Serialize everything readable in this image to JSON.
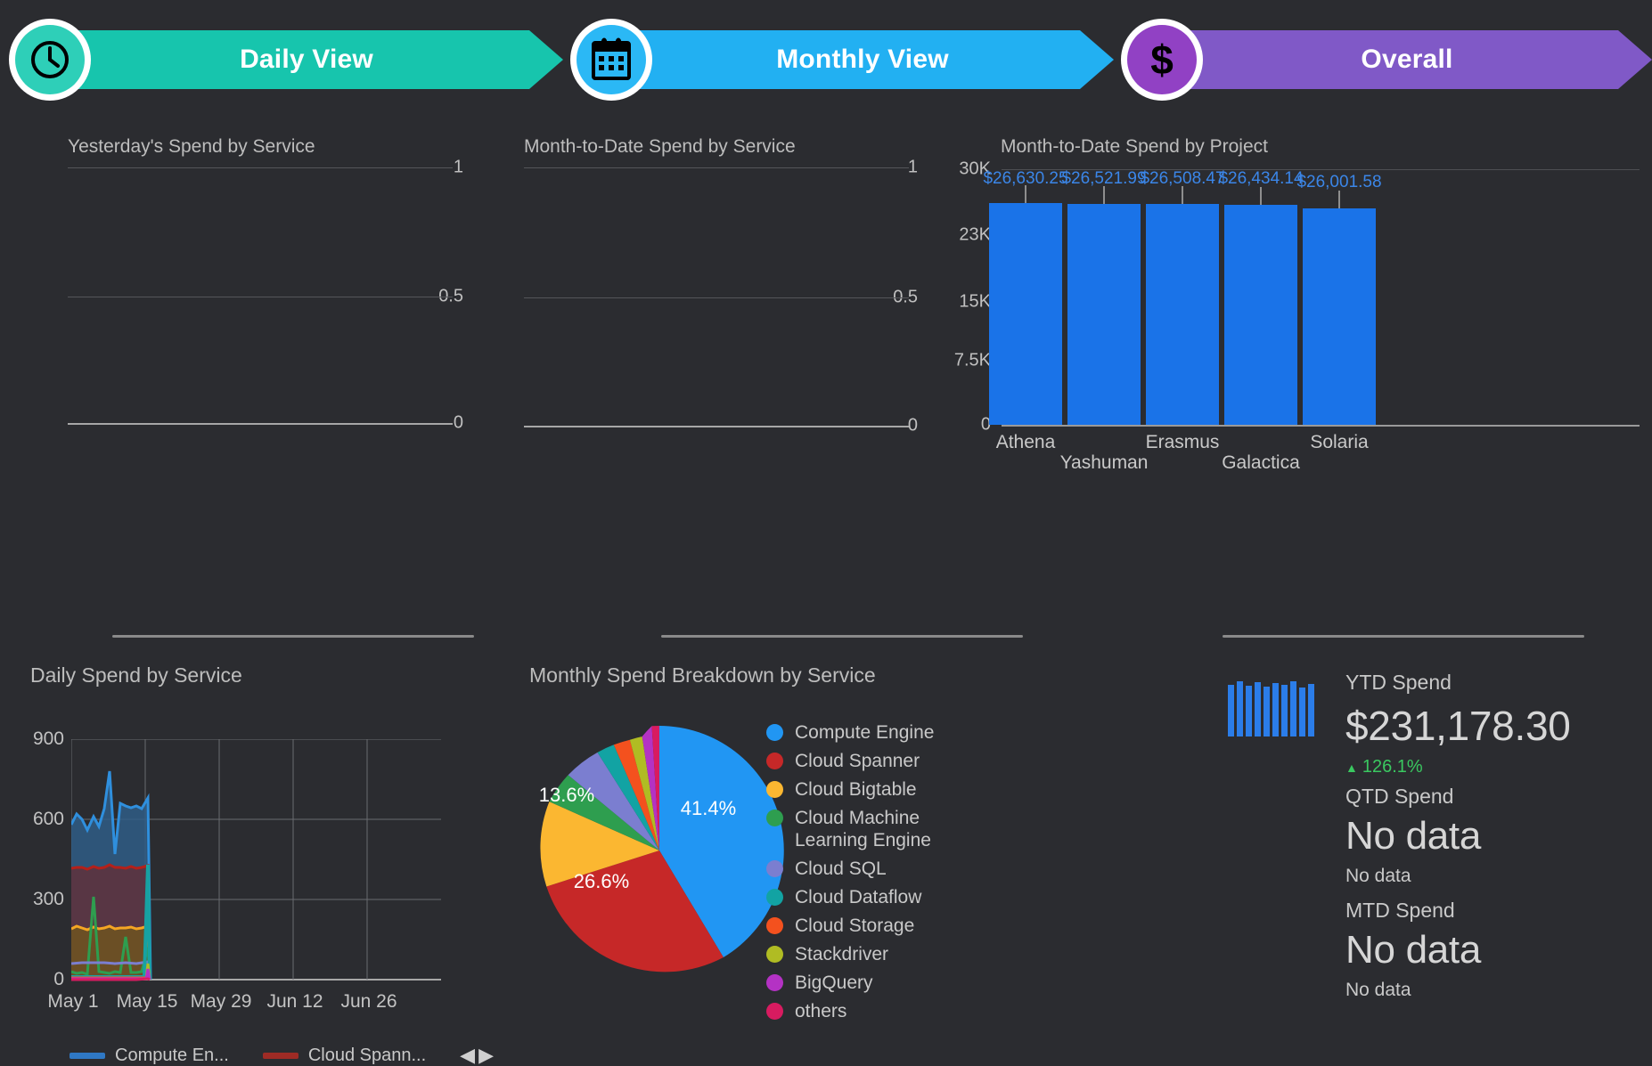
{
  "tabs": [
    {
      "label": "Daily View",
      "icon": "clock-icon",
      "color": "#17c5ad",
      "badge_color": "#2ecfb8"
    },
    {
      "label": "Monthly View",
      "icon": "calendar-icon",
      "color": "#22b0f2",
      "badge_color": "#2bb8f5"
    },
    {
      "label": "Overall",
      "icon": "dollar-icon",
      "color": "#8059c7",
      "badge_color": "#9141c4"
    }
  ],
  "panels": {
    "yesterday_title": "Yesterday's Spend by Service",
    "month_to_date_service_title": "Month-to-Date Spend by Service",
    "month_to_date_project_title": "Month-to-Date Spend by Project",
    "daily_spend_title": "Daily Spend by Service",
    "monthly_breakdown_title": "Monthly Spend Breakdown by Service"
  },
  "chart_data": [
    {
      "type": "bar",
      "title": "Yesterday's Spend by Service",
      "categories": [],
      "values": [],
      "ytick_labels": [
        "1",
        "0.5",
        "0"
      ],
      "ylim": [
        0,
        1
      ],
      "grid": true,
      "empty": true
    },
    {
      "type": "bar",
      "title": "Month-to-Date Spend by Service",
      "categories": [],
      "values": [],
      "ytick_labels": [
        "1",
        "0.5",
        "0"
      ],
      "ylim": [
        0,
        1
      ],
      "grid": true,
      "empty": true
    },
    {
      "type": "bar",
      "title": "Month-to-Date Spend by Project",
      "categories": [
        "Athena",
        "Yashuman",
        "Erasmus",
        "Galactica",
        "Solaria"
      ],
      "values": [
        26630.25,
        26521.99,
        26508.47,
        26434.14,
        26001.58
      ],
      "value_labels": [
        "$26,630.25",
        "$26,521.99",
        "$26,508.47",
        "$26,434.14",
        "$26,001.58"
      ],
      "ytick_labels": [
        "30K",
        "23K",
        "15K",
        "7.5K",
        "0"
      ],
      "ytick_values": [
        30000,
        23000,
        15000,
        7500,
        0
      ],
      "ylim": [
        0,
        30000
      ],
      "xlabel": "",
      "ylabel": "",
      "bar_color": "#1a73e8",
      "grid": true
    },
    {
      "type": "area",
      "title": "Daily Spend by Service",
      "ytick_labels": [
        "900",
        "600",
        "300",
        "0"
      ],
      "ytick_values": [
        900,
        600,
        300,
        0
      ],
      "ylim": [
        0,
        900
      ],
      "xtick_labels": [
        "May 1",
        "May 15",
        "May 29",
        "Jun 12",
        "Jun 26"
      ],
      "grid": true,
      "legend": [
        {
          "label": "Compute En...",
          "color": "#2f78c4"
        },
        {
          "label": "Cloud Spann...",
          "color": "#9e2b25"
        }
      ],
      "pager": {
        "prev": "◀",
        "next": "▶"
      },
      "series": [
        {
          "name": "Compute Engine",
          "color": "#2f78c4",
          "values": [
            580,
            620,
            600,
            560,
            610,
            575,
            640,
            780,
            470,
            660,
            650,
            645,
            650,
            640,
            680,
            0,
            0,
            0,
            0,
            0,
            0,
            0,
            0,
            0,
            0,
            0,
            0,
            0,
            0,
            0
          ]
        },
        {
          "name": "Cloud Spanner",
          "color": "#9e2b25",
          "values": [
            415,
            420,
            418,
            412,
            425,
            415,
            420,
            430,
            418,
            420,
            416,
            422,
            415,
            418,
            425,
            0,
            0,
            0,
            0,
            0,
            0,
            0,
            0,
            0,
            0,
            0,
            0,
            0,
            0,
            0
          ]
        },
        {
          "name": "Cloud Bigtable",
          "color": "#f5a623",
          "values": [
            190,
            200,
            195,
            188,
            198,
            192,
            196,
            200,
            190,
            196,
            193,
            198,
            190,
            195,
            200,
            0,
            0,
            0,
            0,
            0,
            0,
            0,
            0,
            0,
            0,
            0,
            0,
            0,
            0,
            0
          ]
        },
        {
          "name": "Cloud Machine Learning Engine",
          "color": "#2e9e4f",
          "values": [
            30,
            25,
            28,
            20,
            310,
            30,
            26,
            24,
            30,
            28,
            160,
            26,
            28,
            30,
            120,
            0,
            0,
            0,
            0,
            0,
            0,
            0,
            0,
            0,
            0,
            0,
            0,
            0,
            0,
            0
          ]
        },
        {
          "name": "Cloud SQL",
          "color": "#7b7ed0",
          "values": [
            60,
            62,
            61,
            58,
            63,
            60,
            62,
            64,
            60,
            62,
            61,
            63,
            60,
            62,
            64,
            0,
            0,
            0,
            0,
            0,
            0,
            0,
            0,
            0,
            0,
            0,
            0,
            0,
            0,
            0
          ]
        },
        {
          "name": "Cloud Dataflow",
          "color": "#17a2a2",
          "values": [
            10,
            12,
            11,
            10,
            12,
            11,
            12,
            13,
            11,
            12,
            11,
            12,
            11,
            12,
            430,
            0,
            0,
            0,
            0,
            0,
            0,
            0,
            0,
            0,
            0,
            0,
            0,
            0,
            0,
            0
          ]
        },
        {
          "name": "Cloud Storage",
          "color": "#f4511e",
          "values": [
            8,
            9,
            8,
            8,
            9,
            8,
            9,
            9,
            8,
            9,
            8,
            9,
            8,
            9,
            9,
            0,
            0,
            0,
            0,
            0,
            0,
            0,
            0,
            0,
            0,
            0,
            0,
            0,
            0,
            0
          ]
        },
        {
          "name": "Stackdriver",
          "color": "#b0bc23",
          "values": [
            6,
            6,
            6,
            6,
            7,
            6,
            6,
            7,
            6,
            6,
            6,
            7,
            6,
            6,
            60,
            0,
            0,
            0,
            0,
            0,
            0,
            0,
            0,
            0,
            0,
            0,
            0,
            0,
            0,
            0
          ]
        },
        {
          "name": "BigQuery",
          "color": "#b432c4",
          "values": [
            5,
            5,
            5,
            5,
            5,
            5,
            5,
            5,
            5,
            5,
            5,
            5,
            5,
            5,
            40,
            0,
            0,
            0,
            0,
            0,
            0,
            0,
            0,
            0,
            0,
            0,
            0,
            0,
            0,
            0
          ]
        },
        {
          "name": "others",
          "color": "#d81b60",
          "values": [
            4,
            4,
            4,
            4,
            4,
            4,
            4,
            4,
            4,
            4,
            4,
            4,
            4,
            4,
            4,
            0,
            0,
            0,
            0,
            0,
            0,
            0,
            0,
            0,
            0,
            0,
            0,
            0,
            0,
            0
          ]
        }
      ]
    },
    {
      "type": "pie",
      "title": "Monthly Spend Breakdown by Service",
      "legend_position": "right",
      "slices": [
        {
          "label": "Compute Engine",
          "value": 41.4,
          "display": "41.4%",
          "color": "#2196f3",
          "show_label": true
        },
        {
          "label": "Cloud Spanner",
          "value": 26.6,
          "display": "26.6%",
          "color": "#c62828",
          "show_label": true
        },
        {
          "label": "Cloud Bigtable",
          "value": 13.6,
          "display": "13.6%",
          "color": "#fbb731",
          "show_label": true
        },
        {
          "label": "Cloud Machine Learning Engine",
          "value": 6.4,
          "display": "6.4%",
          "color": "#2e9e4f",
          "show_label": false
        },
        {
          "label": "Cloud SQL",
          "value": 5.0,
          "display": "5.0%",
          "color": "#7b7ed0",
          "show_label": false
        },
        {
          "label": "Cloud Dataflow",
          "value": 2.6,
          "display": "2.6%",
          "color": "#12a3a3",
          "show_label": false
        },
        {
          "label": "Cloud Storage",
          "value": 1.9,
          "display": "1.9%",
          "color": "#f4511e",
          "show_label": false
        },
        {
          "label": "Stackdriver",
          "value": 1.3,
          "display": "1.3%",
          "color": "#b0bc23",
          "show_label": false
        },
        {
          "label": "BigQuery",
          "value": 0.8,
          "display": "0.8%",
          "color": "#b432c4",
          "show_label": false
        },
        {
          "label": "others",
          "value": 0.4,
          "display": "0.4%",
          "color": "#d81b60",
          "show_label": false
        }
      ]
    }
  ],
  "scorecards": [
    {
      "label": "YTD Spend",
      "value": "$231,178.30",
      "delta": "126.1%",
      "delta_arrow": "▲",
      "delta_color": "#3ac860",
      "has_sparkline": true
    },
    {
      "label": "QTD Spend",
      "value": "No data",
      "sub": "No data",
      "has_sparkline": false
    },
    {
      "label": "MTD Spend",
      "value": "No data",
      "sub": "No data",
      "has_sparkline": false
    }
  ]
}
